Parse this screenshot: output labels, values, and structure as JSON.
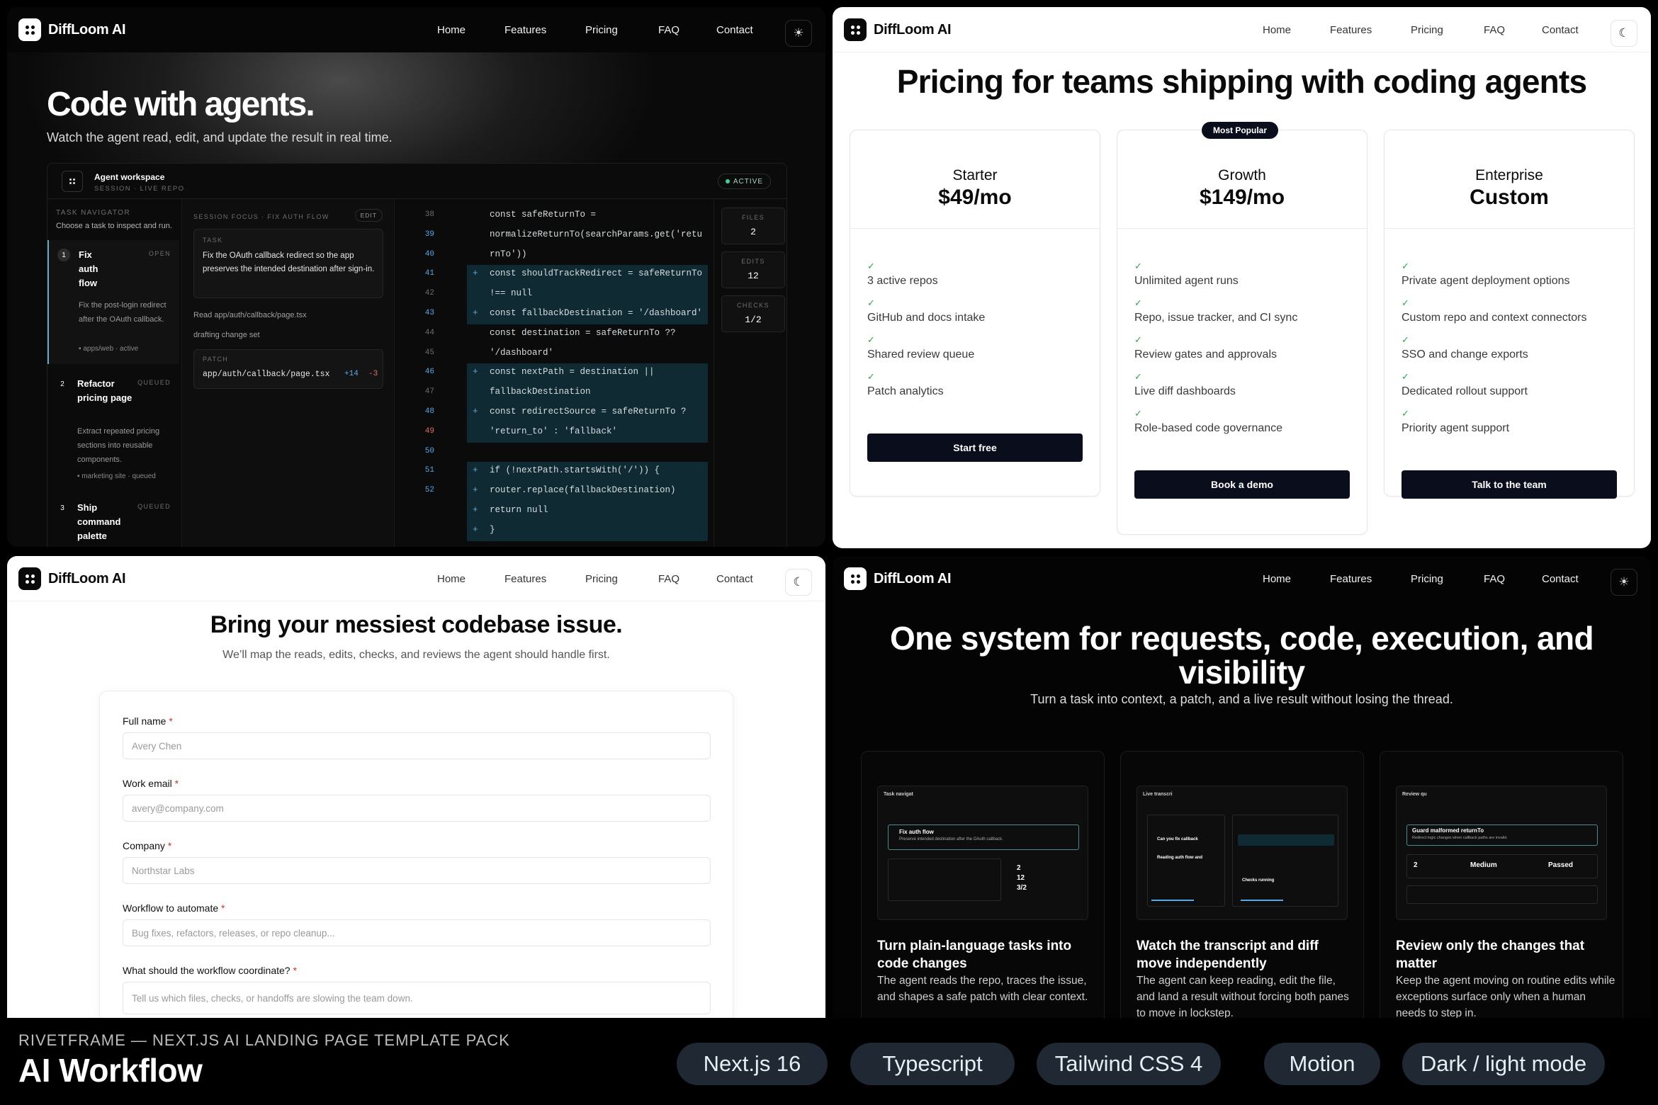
{
  "brand": "DiffLoom AI",
  "nav": [
    "Home",
    "Features",
    "Pricing",
    "FAQ",
    "Contact"
  ],
  "hero": {
    "title": "Code with agents.",
    "subtitle": "Watch the agent read, edit, and update the result in real time."
  },
  "workspace": {
    "title": "Agent workspace",
    "subtitle": "SESSION · LIVE REPO",
    "status": "ACTIVE",
    "navigator_label": "TASK NAVIGATOR",
    "navigator_hint": "Choose a task to inspect and run.",
    "tasks": [
      {
        "num": "1",
        "title": "Fix auth flow",
        "state": "OPEN",
        "desc": "Fix the post-login redirect after the OAuth callback.",
        "meta": "apps/web · active"
      },
      {
        "num": "2",
        "title": "Refactor pricing page",
        "state": "QUEUED",
        "desc": "Extract repeated pricing sections into reusable components.",
        "meta": "marketing site · queued"
      },
      {
        "num": "3",
        "title": "Ship command palette",
        "state": "QUEUED"
      }
    ],
    "focus_label": "SESSION FOCUS · FIX AUTH FLOW",
    "edit_label": "EDIT",
    "task_label": "TASK",
    "task_text": "Fix the OAuth callback redirect so the app preserves the intended destination after sign-in.",
    "read_line": "Read app/auth/callback/page.tsx",
    "drafting_line": "drafting change set",
    "patch_label": "PATCH",
    "patch_file": "app/auth/callback/page.tsx",
    "patch_add": "+14",
    "patch_del": "-3",
    "code": [
      {
        "n": "38",
        "t": "  const safeReturnTo =",
        "m": ""
      },
      {
        "n": "39",
        "t": "normalizeReturnTo(searchParams.get('retu",
        "m": ""
      },
      {
        "n": "40",
        "t": "rnTo'))",
        "m": ""
      },
      {
        "n": "41",
        "t": "const shouldTrackRedirect = safeReturnTo",
        "m": "+"
      },
      {
        "n": "42",
        "t": "!== null",
        "m": ""
      },
      {
        "n": "43",
        "t": "const fallbackDestination = '/dashboard'",
        "m": "+"
      },
      {
        "n": "44",
        "t": "  const destination = safeReturnTo ??",
        "m": ""
      },
      {
        "n": "45",
        "t": "'/dashboard'",
        "m": ""
      },
      {
        "n": "46",
        "t": "const nextPath = destination ||",
        "m": "+"
      },
      {
        "n": "47",
        "t": "fallbackDestination",
        "m": ""
      },
      {
        "n": "48",
        "t": "const redirectSource = safeReturnTo ?",
        "m": "+"
      },
      {
        "n": "49",
        "t": "'return_to' : 'fallback'",
        "m": ""
      },
      {
        "n": "50",
        "t": "",
        "m": ""
      },
      {
        "n": "51",
        "t": "if (!nextPath.startsWith('/')) {",
        "m": "+"
      },
      {
        "n": "52",
        "t": "router.replace(fallbackDestination)",
        "m": "+"
      },
      {
        "n": "",
        "t": "return null",
        "m": "+"
      },
      {
        "n": "",
        "t": "}",
        "m": "+"
      }
    ],
    "stats": [
      {
        "label": "FILES",
        "value": "2"
      },
      {
        "label": "EDITS",
        "value": "12"
      },
      {
        "label": "CHECKS",
        "value": "1/2"
      }
    ]
  },
  "pricing": {
    "title": "Pricing for teams shipping with coding agents",
    "badge": "Most Popular",
    "plans": [
      {
        "name": "Starter",
        "price": "$49/mo",
        "features": [
          "3 active repos",
          "GitHub and docs intake",
          "Shared review queue",
          "Patch analytics"
        ],
        "cta": "Start free"
      },
      {
        "name": "Growth",
        "price": "$149/mo",
        "features": [
          "Unlimited agent runs",
          "Repo, issue tracker, and CI sync",
          "Review gates and approvals",
          "Live diff dashboards",
          "Role-based code governance"
        ],
        "cta": "Book a demo"
      },
      {
        "name": "Enterprise",
        "price": "Custom",
        "features": [
          "Private agent deployment options",
          "Custom repo and context connectors",
          "SSO and change exports",
          "Dedicated rollout support",
          "Priority agent support"
        ],
        "cta": "Talk to the team"
      }
    ],
    "check": "✓"
  },
  "contact": {
    "title": "Bring your messiest codebase issue.",
    "subtitle": "We’ll map the reads, edits, checks, and reviews the agent should handle first.",
    "required": "*",
    "fields": [
      {
        "label": "Full name",
        "placeholder": "Avery Chen"
      },
      {
        "label": "Work email",
        "placeholder": "avery@company.com"
      },
      {
        "label": "Company",
        "placeholder": "Northstar Labs"
      },
      {
        "label": "Workflow to automate",
        "placeholder": "Bug fixes, refactors, releases, or repo cleanup..."
      },
      {
        "label": "What should the workflow coordinate?",
        "placeholder": "Tell us which files, checks, or handoffs are slowing the team down."
      }
    ]
  },
  "features": {
    "title": "One system for requests, code, execution, and visibility",
    "subtitle": "Turn a task into context, a patch, and a live result without losing the thread.",
    "cards": [
      {
        "title": "Turn plain-language tasks into code changes",
        "desc": "The agent reads the repo, traces the issue, and shapes a safe patch with clear context.",
        "shot_head": "Task navigat",
        "shot_main": "Fix auth flow",
        "shot_sub": "Preserve intended destination after the OAuth callback.",
        "shot_stat": "2",
        "shot_stat2": "12",
        "shot_stat3": "3/2"
      },
      {
        "title": "Watch the transcript and diff move independently",
        "desc": "The agent can keep reading, edit the file, and land a result without forcing both panes to move in lockstep.",
        "shot_head": "Live transcri",
        "shot_main": "Can you fix callback",
        "shot_sub": "Reading auth flow and",
        "shot_stat": "Checks running"
      },
      {
        "title": "Review only the changes that matter",
        "desc": "Keep the agent moving on routine edits while exceptions surface only when a human needs to step in.",
        "shot_head": "Review qu",
        "shot_main": "Guard malformed returnTo",
        "shot_sub": "Redirect logic changes when callback paths are invalid.",
        "shot_stat": "2",
        "shot_stat2": "Medium",
        "shot_stat3": "Passed"
      }
    ]
  },
  "footer": {
    "subtitle": "RIVETFRAME — NEXT.JS AI LANDING PAGE TEMPLATE PACK",
    "title": "AI Workflow",
    "pills": [
      "Next.js 16",
      "Typescript",
      "Tailwind CSS 4",
      "Motion",
      "Dark / light mode"
    ]
  },
  "colors": {
    "accent_dark": "#0a0d1c",
    "check_green": "#2ea44f",
    "code_blue": "#5aa9e6",
    "code_teal": "#0f2a33"
  }
}
